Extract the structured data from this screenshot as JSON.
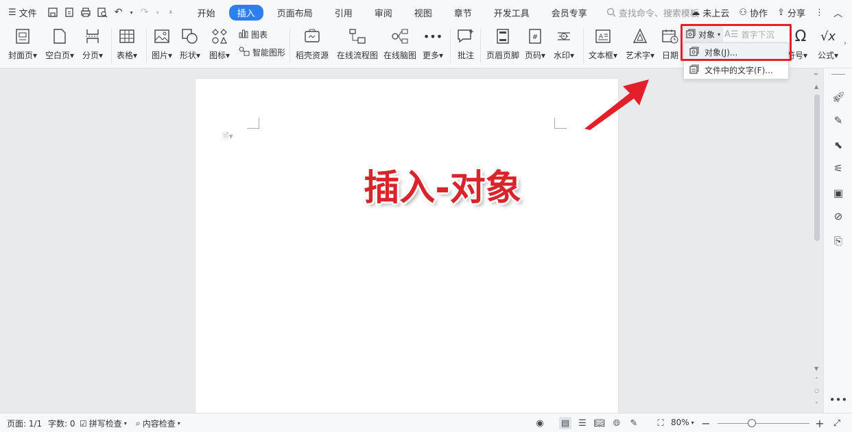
{
  "menubar": {
    "file_label": "文件",
    "tabs": [
      {
        "label": "开始",
        "active": false
      },
      {
        "label": "插入",
        "active": true
      },
      {
        "label": "页面布局",
        "active": false
      },
      {
        "label": "引用",
        "active": false
      },
      {
        "label": "审阅",
        "active": false
      },
      {
        "label": "视图",
        "active": false
      },
      {
        "label": "章节",
        "active": false
      },
      {
        "label": "开发工具",
        "active": false
      },
      {
        "label": "会员专享",
        "active": false
      }
    ],
    "search_placeholder": "查找命令、搜索模板",
    "cloud_label": "未上云",
    "collab_label": "协作",
    "share_label": "分享"
  },
  "ribbon": {
    "cover": "封面页",
    "blank": "空白页",
    "pagebreak": "分页",
    "table": "表格",
    "picture": "图片",
    "shape": "形状",
    "icon": "图标",
    "chart": "图表",
    "smartart": "智能图形",
    "docer": "稻壳资源",
    "flowchart": "在线流程图",
    "mindmap": "在线脑图",
    "more": "更多",
    "comment": "批注",
    "headerfooter": "页眉页脚",
    "pagenum": "页码",
    "watermark": "水印",
    "textbox": "文本框",
    "wordart": "艺术字",
    "date": "日期",
    "symbol": "符号",
    "formula": "公式",
    "object": "对象",
    "dropcap": "首字下沉"
  },
  "object_menu": {
    "items": [
      "对象(J)...",
      "文件中的文字(F)..."
    ]
  },
  "document": {
    "headline": "插入-对象"
  },
  "status": {
    "page": "页面: 1/1",
    "words": "字数: 0",
    "spell": "拼写检查",
    "content": "内容检查",
    "zoom": "80%"
  },
  "colors": {
    "accent": "#2d7ff0",
    "highlight_red": "#e3202a",
    "headline_red": "#d7252b"
  }
}
